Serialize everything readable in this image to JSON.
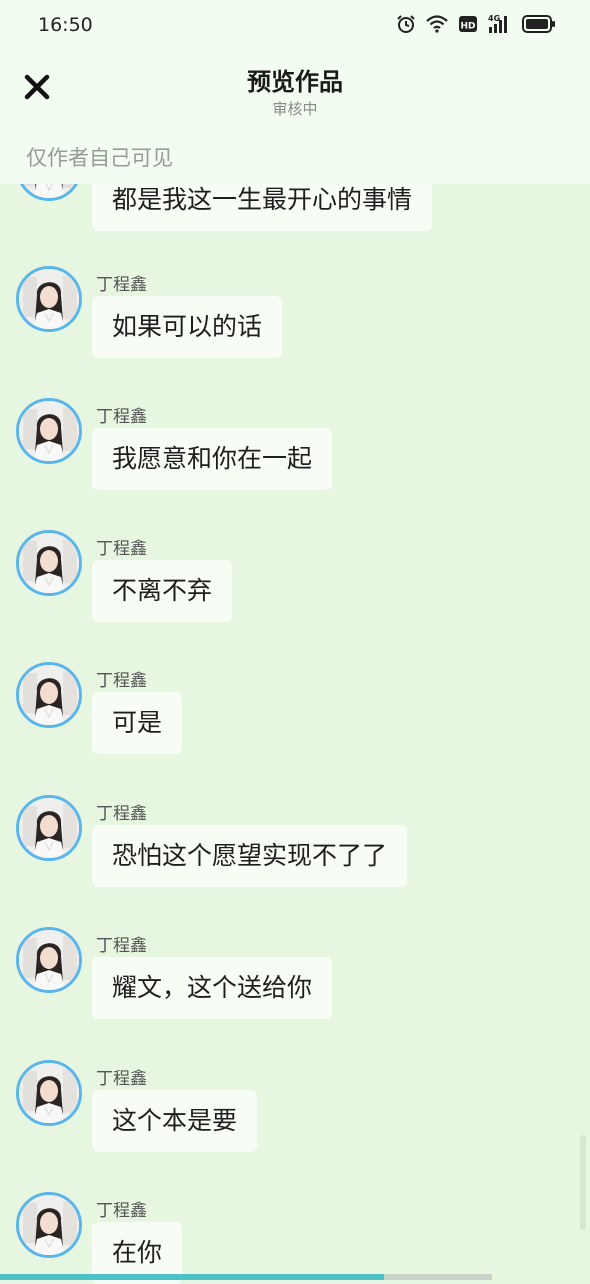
{
  "status_bar": {
    "time": "16:50",
    "hd_label": "HD",
    "network_label": "4G"
  },
  "header": {
    "title": "预览作品",
    "subtitle": "审核中",
    "visibility_note": "仅作者自己可见"
  },
  "messages": [
    {
      "sender": "",
      "text": "都是我这一生最开心的事情"
    },
    {
      "sender": "丁程鑫",
      "text": "如果可以的话"
    },
    {
      "sender": "丁程鑫",
      "text": "我愿意和你在一起"
    },
    {
      "sender": "丁程鑫",
      "text": "不离不弃"
    },
    {
      "sender": "丁程鑫",
      "text": "可是"
    },
    {
      "sender": "丁程鑫",
      "text": "恐怕这个愿望实现不了了"
    },
    {
      "sender": "丁程鑫",
      "text": "耀文，这个送给你"
    },
    {
      "sender": "丁程鑫",
      "text": "这个本是要"
    },
    {
      "sender": "丁程鑫",
      "text": "在你"
    }
  ],
  "reading_progress": 0.78,
  "colors": {
    "background": "#e6f6e0",
    "bubble": "#f7fdf5",
    "avatar_ring": "#5ab6ea",
    "progress": "#4cc2c8"
  }
}
